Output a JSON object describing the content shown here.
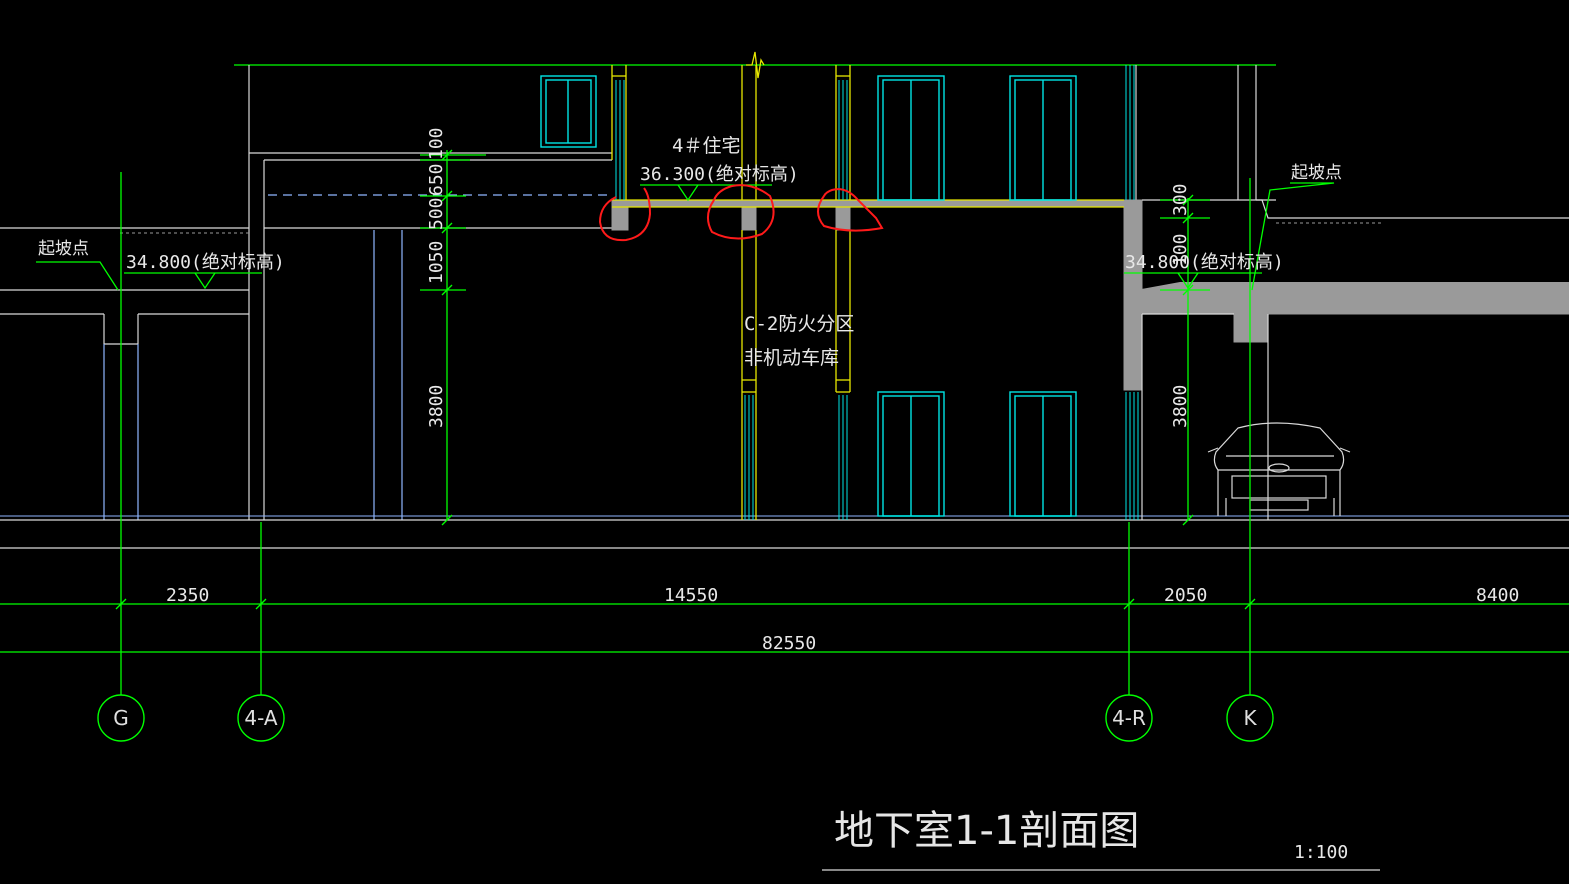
{
  "drawing": {
    "title": "地下室1-1剖面图",
    "scale": "1:100",
    "colors": {
      "background": "#000000",
      "grid_line": "#00ff00",
      "building_line": "#d9d9d9",
      "wall_yellow": "#e6e600",
      "window_cyan": "#00e5e5",
      "wall_blue": "#8fb6ff",
      "slab_fill": "#9a9a9a",
      "markup_red": "#ff1a1a",
      "text": "#e8e8e8"
    }
  },
  "labels": {
    "building_name": "4＃住宅",
    "elevation_high": "36.300(绝对标高)",
    "elevation_left": "34.800(绝对标高)",
    "elevation_right": "34.800(绝对标高)",
    "slope_start_left": "起坡点",
    "slope_start_right": "起坡点",
    "zone_line1": "C-2防火分区",
    "zone_line2": "非机动车库"
  },
  "vertical_dimensions": {
    "left": [
      "100",
      "650",
      "500",
      "1050",
      "3800"
    ],
    "right": [
      "300",
      "100",
      "3800"
    ]
  },
  "horizontal_dimensions": {
    "segments": [
      "2350",
      "14550",
      "2050",
      "8400"
    ],
    "total": "82550"
  },
  "axes": [
    "G",
    "4-A",
    "4-R",
    "K"
  ],
  "car_icon": "car-elevation-icon"
}
